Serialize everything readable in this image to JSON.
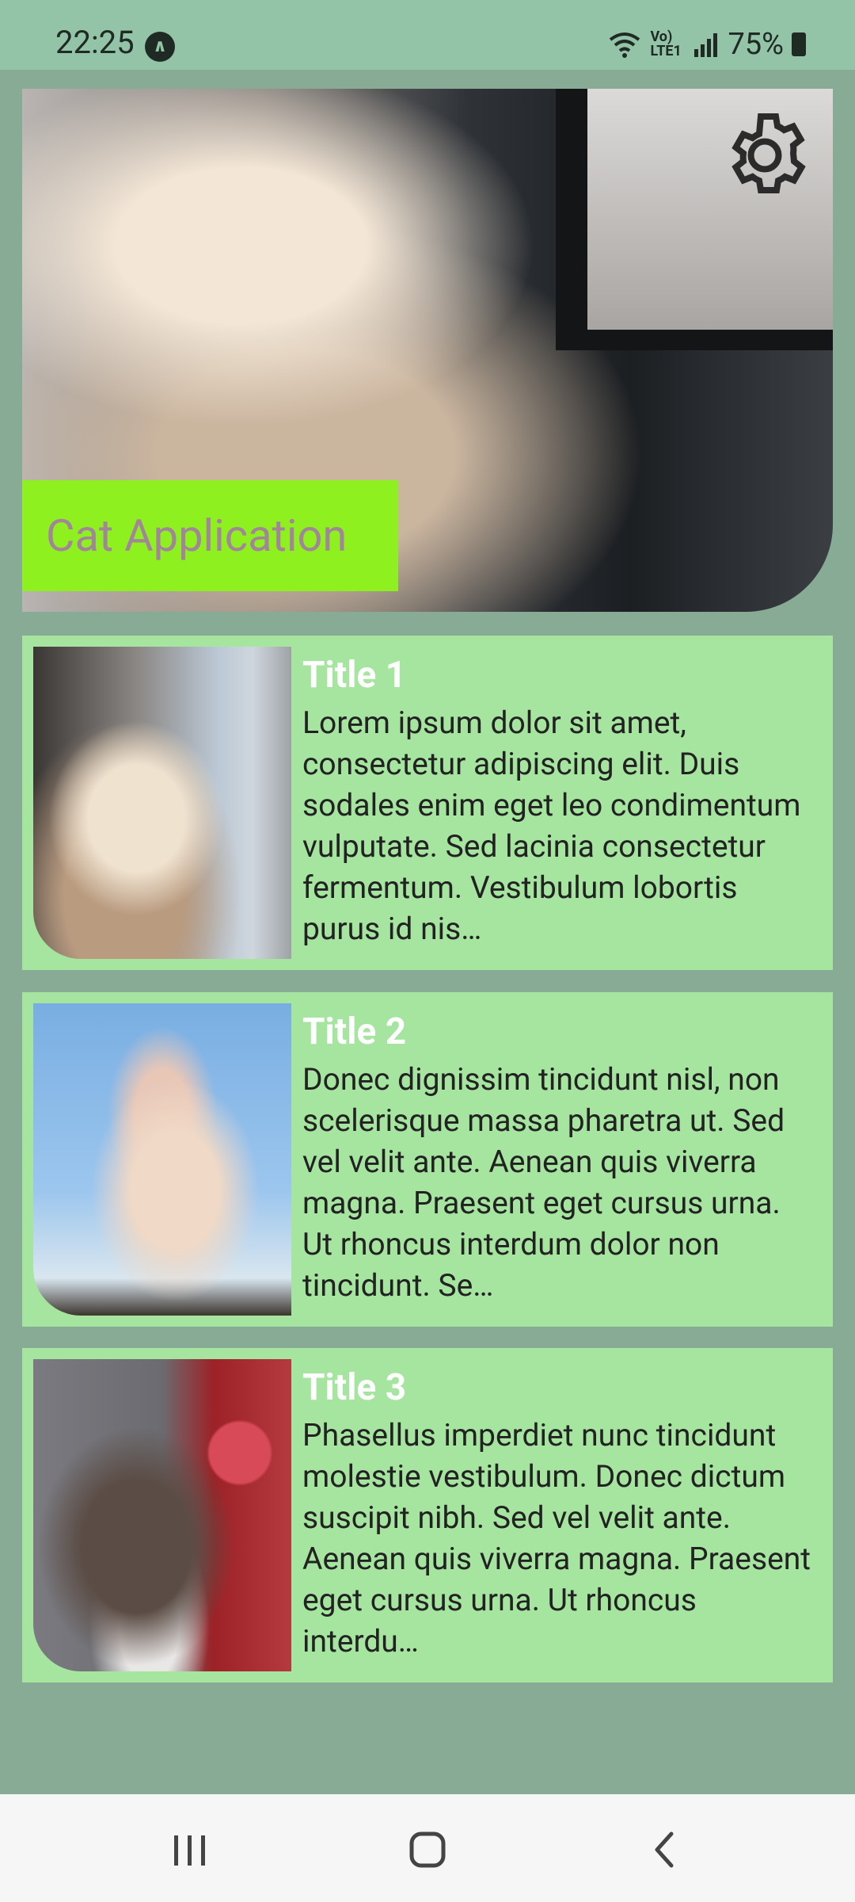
{
  "status_bar": {
    "time": "22:25",
    "nav_badge": "∧",
    "network": "Vo) LTE1",
    "battery": "75%"
  },
  "hero": {
    "app_title": "Cat Application",
    "settings_icon": "gear-icon",
    "title_box_color": "#8ff01f",
    "title_text_color": "#a2859a"
  },
  "cards": [
    {
      "title": "Title 1",
      "body": "Lorem ipsum dolor sit amet, consectetur adipiscing elit. Duis sodales enim eget leo condimentum vulputate. Sed lacinia consectetur fermentum. Vestibulum lobortis purus id nis…"
    },
    {
      "title": "Title 2",
      "body": "Donec dignissim tincidunt nisl, non scelerisque massa pharetra ut. Sed vel velit ante. Aenean quis viverra magna. Praesent eget cursus urna. Ut rhoncus interdum dolor non tincidunt. Se…"
    },
    {
      "title": "Title 3",
      "body": "Phasellus imperdiet nunc tincidunt molestie vestibulum. Donec dictum suscipit nibh. Sed vel velit ante. Aenean quis viverra magna. Praesent eget cursus urna. Ut rhoncus interdu…"
    }
  ],
  "colors": {
    "background": "#88ab96",
    "card_background": "#a5e59f",
    "status_bar": "#93c4a8"
  },
  "nav_bar": {
    "recents_icon": "recents-icon",
    "home_icon": "home-icon",
    "back_icon": "back-icon"
  }
}
